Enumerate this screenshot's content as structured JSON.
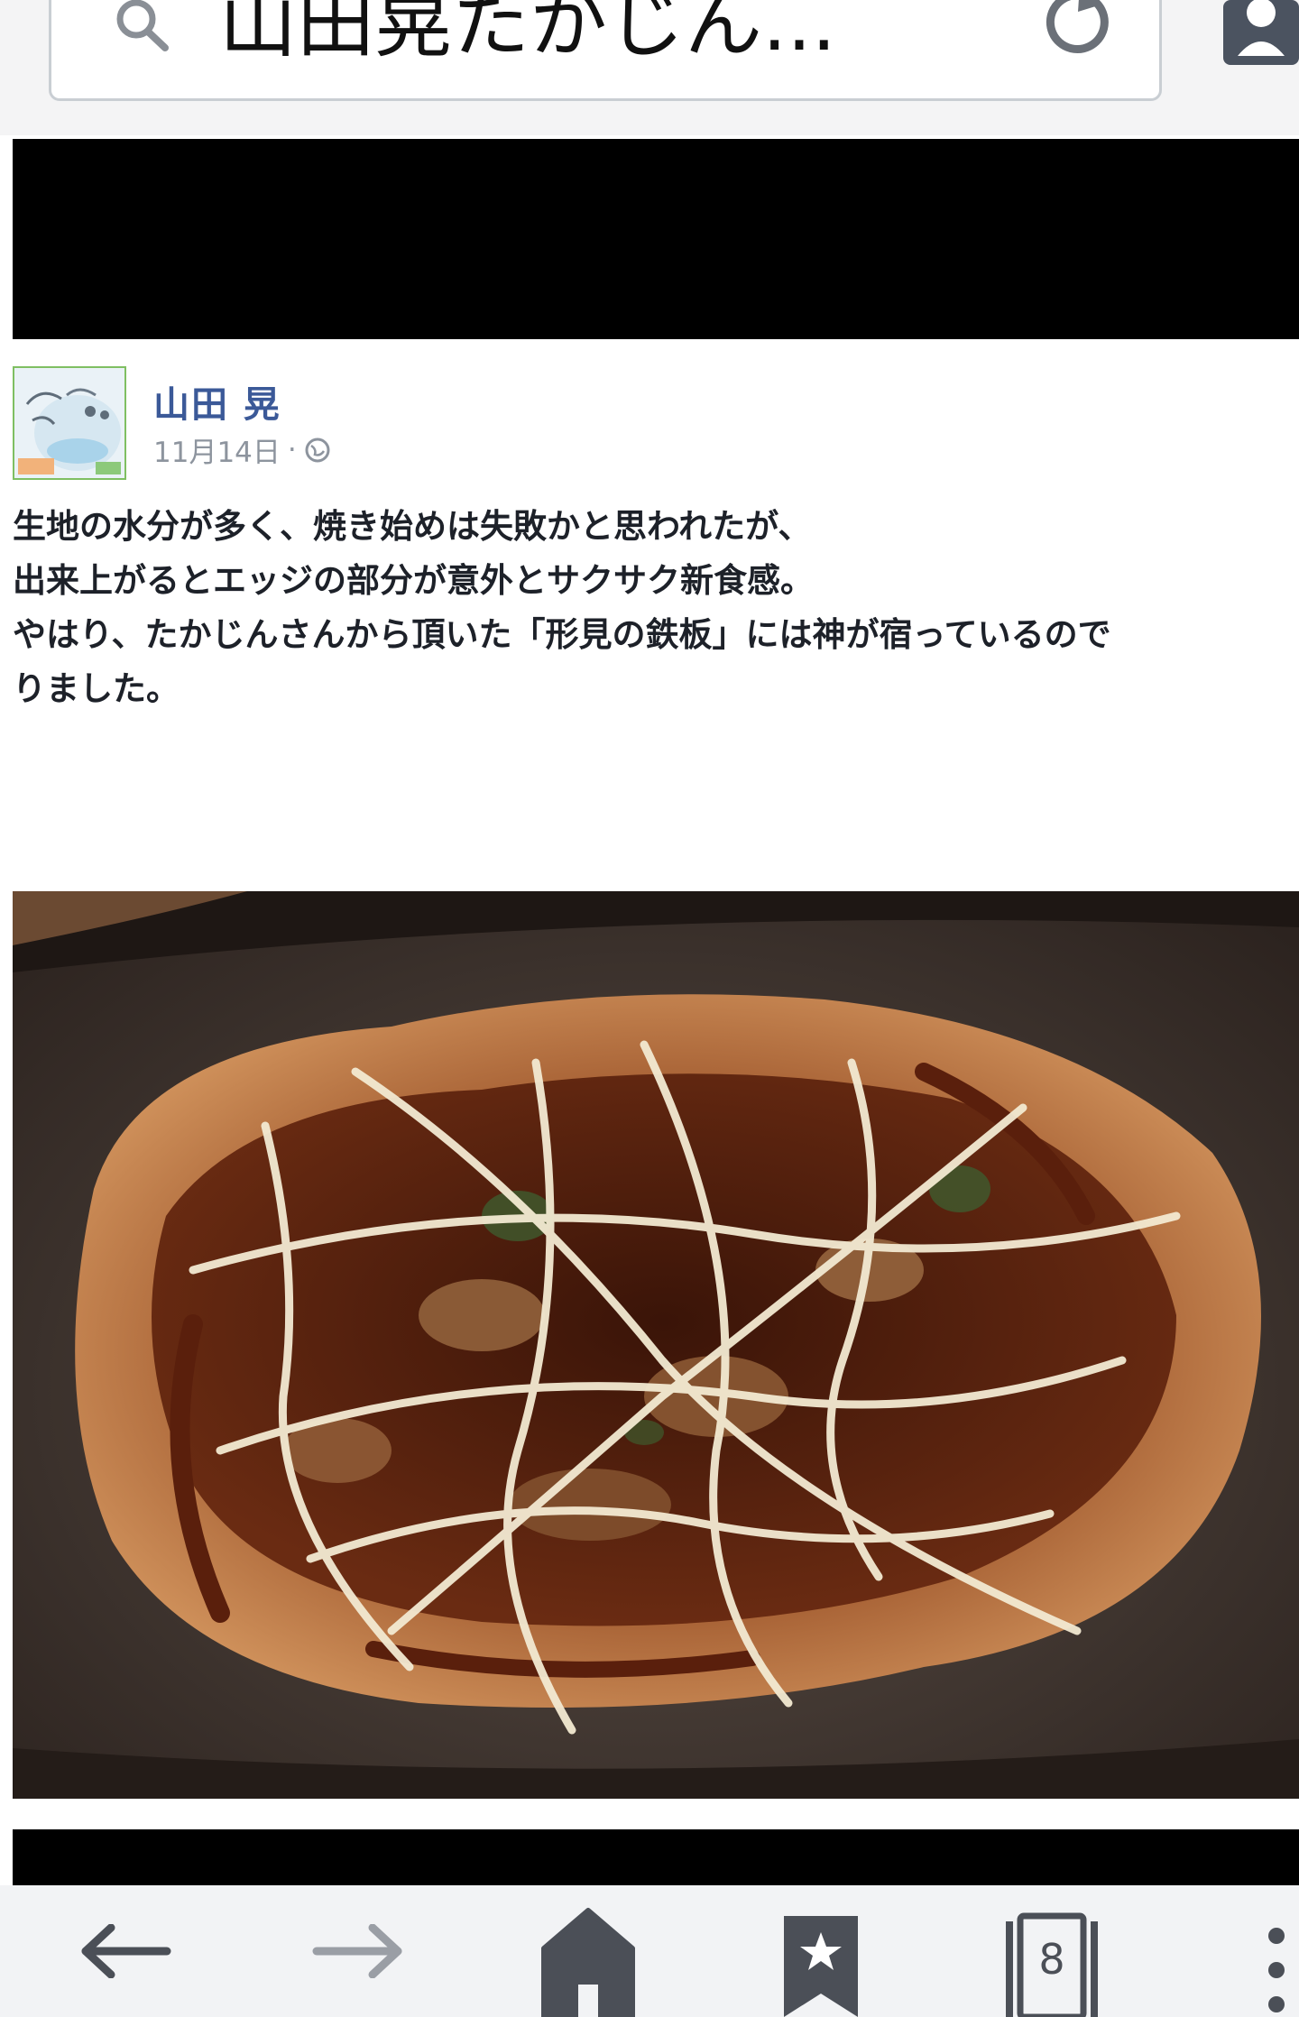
{
  "address_bar": {
    "url_text": "山田晃たかじん..."
  },
  "post": {
    "author": "山田 晃",
    "date": "11月14日",
    "separator": "·",
    "text_lines": [
      "生地の水分が多く、焼き始めは失敗かと思われたが、",
      "出来上がるとエッジの部分が意外とサクサク新食感。",
      "やはり、たかじんさんから頂いた「形見の鉄板」には神が宿っているので",
      "りました。"
    ]
  },
  "toolbar": {
    "tab_count": "8"
  },
  "icons": {
    "search": "search-icon",
    "reload": "reload-icon",
    "profile": "profile-icon",
    "globe": "globe-icon",
    "back": "back-arrow-icon",
    "forward": "forward-arrow-icon",
    "home": "home-icon",
    "bookmark": "bookmark-star-icon",
    "tabs": "tabs-icon",
    "menu": "menu-dots-icon"
  },
  "colors": {
    "author_link": "#3b5998",
    "meta_gray": "#8d949e",
    "toolbar_icon": "#4b4f57",
    "url_border": "#c9ced3"
  }
}
